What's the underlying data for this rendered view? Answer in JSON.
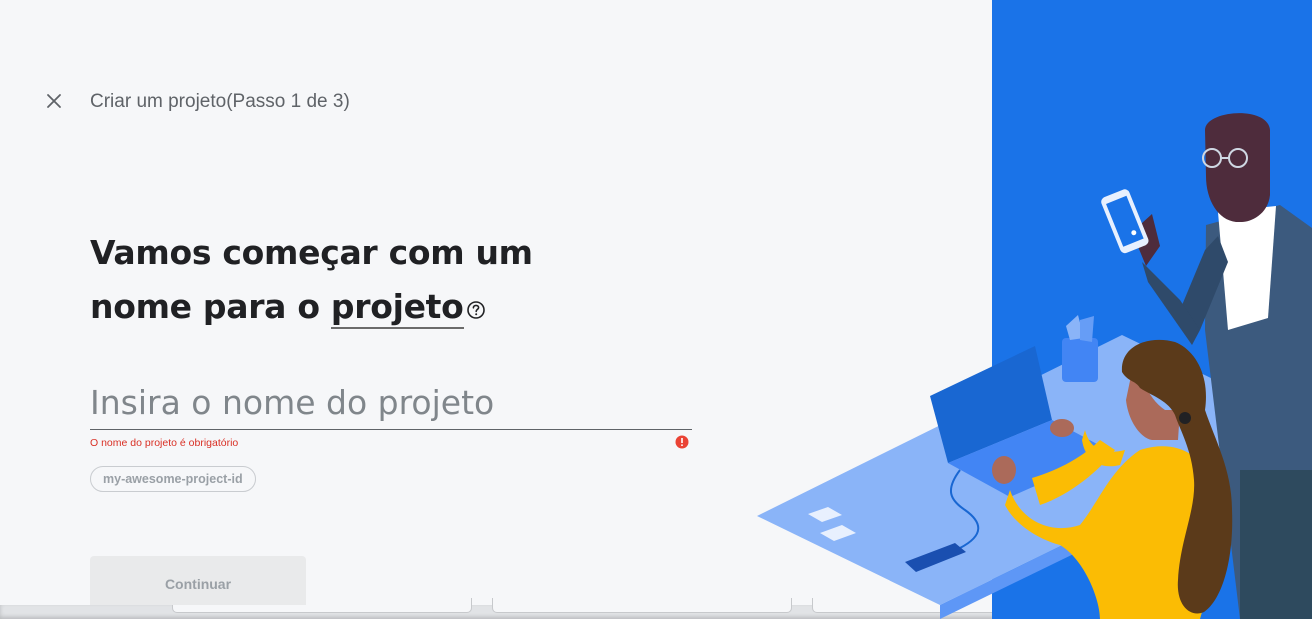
{
  "header": {
    "title": "Criar um projeto(Passo 1 de 3)"
  },
  "main": {
    "headline_line1": "Vamos começar com um",
    "headline_line2_prefix": "nome para o ",
    "headline_term": "projeto",
    "input": {
      "placeholder": "Insira o nome do projeto",
      "value": ""
    },
    "error_message": "O nome do projeto é obrigatório",
    "project_id_chip": "my-awesome-project-id",
    "continue_label": "Continuar"
  },
  "icons": {
    "close": "close-icon",
    "help": "help-circle-icon",
    "error": "error-icon"
  },
  "colors": {
    "background": "#f6f7f9",
    "illustration_blue": "#1a73e8",
    "error_red": "#ea4335",
    "person_yellow": "#fbbc04"
  }
}
